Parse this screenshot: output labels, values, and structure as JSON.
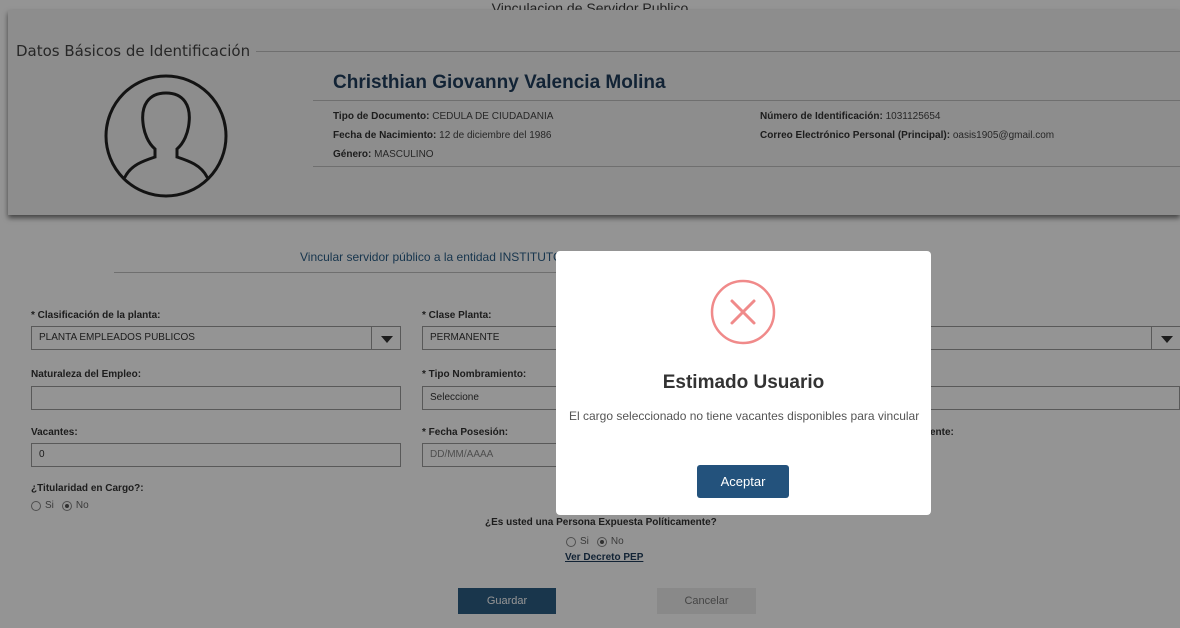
{
  "page": {
    "title": "Vinculacion de Servidor Publico"
  },
  "card": {
    "title": "Datos Básicos de Identificación",
    "name": "Christhian Giovanny Valencia Molina",
    "tipo_documento_label": "Tipo de Documento:",
    "tipo_documento_value": "CEDULA DE CIUDADANIA",
    "fecha_nacimiento_label": "Fecha de Nacimiento:",
    "fecha_nacimiento_value": "12 de diciembre del 1986",
    "genero_label": "Género:",
    "genero_value": "MASCULINO",
    "numero_id_label": "Número de Identificación:",
    "numero_id_value": "1031125654",
    "correo_label": "Correo Electrónico Personal (Principal):",
    "correo_value": "oasis1905@gmail.com"
  },
  "form": {
    "vincular_text": "Vincular servidor público a la entidad INSTITUTO",
    "clasificacion_label": "* Clasificación de la planta:",
    "clasificacion_value": "PLANTA EMPLEADOS PUBLICOS",
    "clase_label": "* Clase Planta:",
    "clase_value": "PERMANENTE",
    "naturaleza_label": "Naturaleza del Empleo:",
    "naturaleza_value": "",
    "tipo_nombramiento_label": "* Tipo Nombramiento:",
    "tipo_nombramiento_value": "Seleccione",
    "vacantes_label": "Vacantes:",
    "vacantes_value": "0",
    "fecha_posesion_label": "* Fecha Posesión:",
    "fecha_posesion_placeholder": "DD/MM/AAAA",
    "right_col_fragment": "ente:",
    "titularidad_label": "¿Titularidad en Cargo?:",
    "si_label": "Si",
    "no_label": "No",
    "pep_question": "¿Es usted una Persona Expuesta Políticamente?",
    "pep_link": "Ver Decreto PEP",
    "guardar": "Guardar",
    "cancelar": "Cancelar"
  },
  "modal": {
    "title": "Estimado Usuario",
    "message": "El cargo seleccionado no tiene vacantes disponibles para vincular",
    "button": "Aceptar",
    "icon": "error-x-circle-icon",
    "icon_color": "#f08a8a"
  },
  "colors": {
    "primary": "#2b5d84",
    "heading": "#1f3d5c"
  }
}
